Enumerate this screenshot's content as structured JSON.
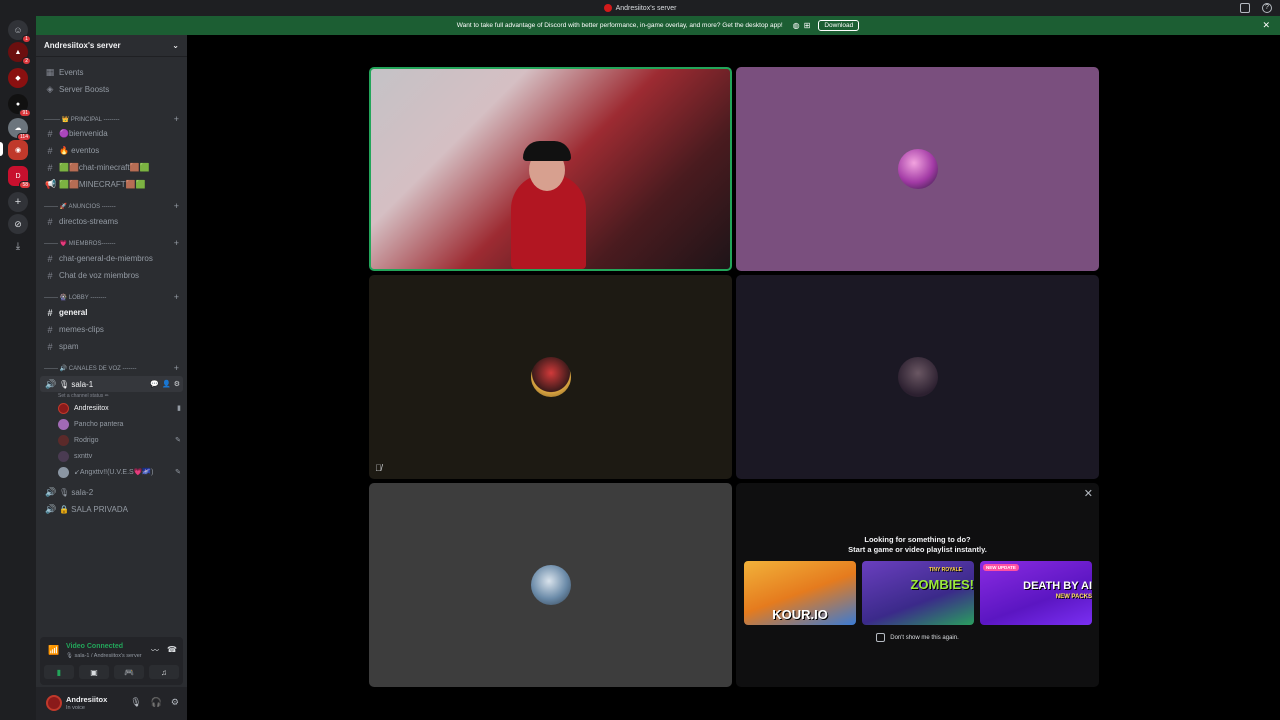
{
  "window": {
    "title": "Andresiitox's server"
  },
  "notice": {
    "text": "Want to take full advantage of Discord with better performance, in-game overlay, and more? Get the desktop app!",
    "download_label": "Download"
  },
  "rail": {
    "badges": [
      "1",
      "2",
      "91",
      "114",
      "58"
    ]
  },
  "server": {
    "name": "Andresiitox's server",
    "top_items": [
      "Events",
      "Server Boosts"
    ]
  },
  "categories": {
    "principal": "-------- 👑 PRINCIPAL --------",
    "anuncios": "------- 🚀 ANUNCIOS -------",
    "miembros": "------- 💗 MIEMBROS-------",
    "lobby": "------- 🎡 LOBBY --------",
    "voz": "------- 🔊 CANALES DE VOZ -------"
  },
  "channels": {
    "bienvenida": "🟣bienvenida",
    "eventos": "🔥 eventos",
    "chat_minecraft": "🟩🟫chat-minecraft🟫🟩",
    "minecraft": "🟩🟫MINECRAFT🟫🟩",
    "directos": "directos-streams",
    "chat_general": "chat-general-de-miembros",
    "chat_voz": "Chat de voz miembros",
    "general": "general",
    "memes": "memes-clips",
    "spam": "spam",
    "sala1": "🎙 sala-1",
    "sala1_status": "Set a channel status ✏",
    "sala2": "🎙 sala-2",
    "privada": "🔒 SALA PRIVADA"
  },
  "voice_users": [
    {
      "name": "Andresiitox"
    },
    {
      "name": "Pancho pantera"
    },
    {
      "name": "Rodrigo"
    },
    {
      "name": "sxnttv"
    },
    {
      "name": "↙Angxttv!!(U.V.E.S💗🌌)"
    }
  ],
  "voice_panel": {
    "status": "Video Connected",
    "location": "🎙 sala-1 / Andresiitox's server"
  },
  "user_panel": {
    "name": "Andresiitox",
    "status": "In voice"
  },
  "activity": {
    "title_line1": "Looking for something to do?",
    "title_line2": "Start a game or video playlist instantly.",
    "games": [
      "KOUR.IO",
      "ZOMBIES!",
      "DEATH BY AI"
    ],
    "game_tags": [
      "TINY ROYALE",
      "NEW PACKS",
      "NEW UPDATE"
    ],
    "dont_show": "Don't show me this again."
  },
  "colors": {
    "tile_purple": "#7a4f7e",
    "tile_brown": "#1d1a13",
    "tile_navy": "#1b1824",
    "tile_gray": "#3d3d3d",
    "speaking_border": "#23a55a",
    "notice_green": "#1c5e33"
  }
}
